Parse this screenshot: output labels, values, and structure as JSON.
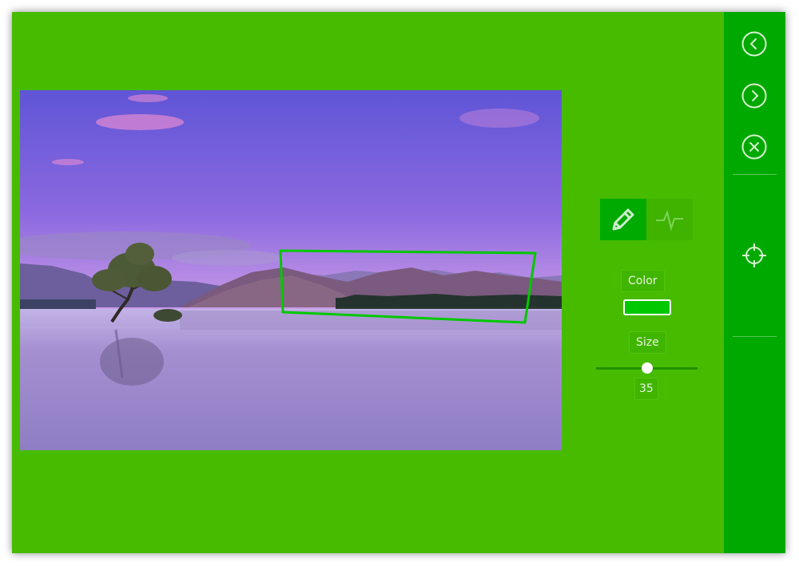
{
  "sidebar": {
    "icons": [
      "chevron-left-icon",
      "chevron-right-icon",
      "close-circle-icon",
      "crosshair-icon"
    ]
  },
  "tools": {
    "active": "pencil-icon",
    "inactive": "pulse-icon"
  },
  "color_panel": {
    "label": "Color",
    "value": "#00c800"
  },
  "size_panel": {
    "label": "Size",
    "value": "35",
    "fraction": 0.5
  },
  "colors": {
    "background": "#47bb00",
    "sidebar": "#00a900",
    "annotation": "#00c800"
  }
}
